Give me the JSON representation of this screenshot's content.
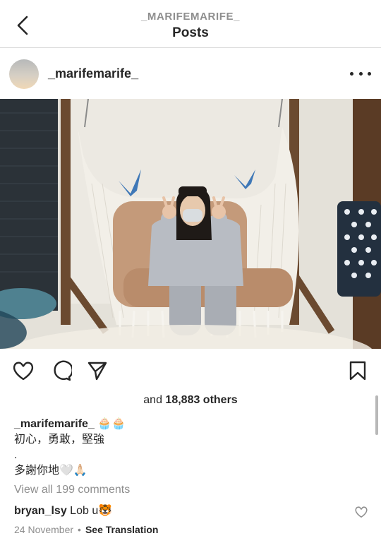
{
  "header": {
    "username": "_MARIFEMARIFE_",
    "title": "Posts",
    "back_icon": "chevron-left-icon"
  },
  "post": {
    "username": "_marifemarife_",
    "more_icon": "more-horizontal-icon",
    "image_alt": "Person in light grey sweatsuit and face mask sitting in a hanging macrame chair, making peace signs, with two blue check marks drawn above"
  },
  "actions": {
    "like_icon": "heart-icon",
    "comment_icon": "comment-icon",
    "share_icon": "send-icon",
    "save_icon": "bookmark-icon"
  },
  "likes": {
    "prefix": "and ",
    "count": "18,883 others"
  },
  "caption": {
    "username": "_marifemarife_",
    "emoji": "🧁🧁",
    "line1": "初心，勇敢，堅強",
    "line2": ".",
    "line3": "多謝你地🤍🙏🏻"
  },
  "comments": {
    "view_all": "View all 199 comments",
    "first_user": "bryan_lsy",
    "first_text": "Lob u🐯"
  },
  "meta": {
    "date": "24 November",
    "separator": "•",
    "translate": "See Translation"
  },
  "colors": {
    "text": "#262626",
    "muted": "#8e8e8e",
    "divider": "#dbdbdb",
    "check_blue": "#3f78b7"
  }
}
